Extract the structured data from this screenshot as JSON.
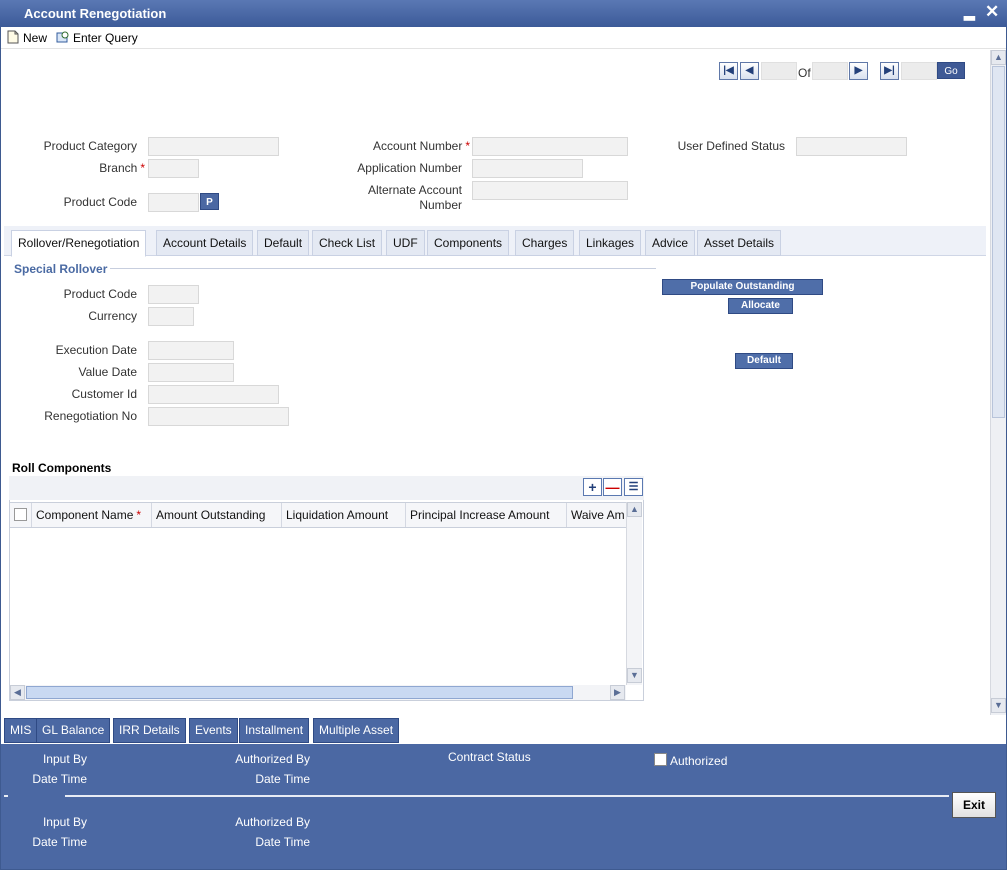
{
  "window": {
    "title": "Account Renegotiation"
  },
  "toolbar": {
    "new_label": "New",
    "enter_query_label": "Enter Query"
  },
  "pager": {
    "of_label": "Of",
    "go_label": "Go"
  },
  "header_fields": {
    "product_category": {
      "label": "Product Category",
      "value": ""
    },
    "branch": {
      "label": "Branch",
      "required": "*",
      "value": ""
    },
    "product_code": {
      "label": "Product Code",
      "value": "",
      "lookup_label": "P"
    },
    "account_number": {
      "label": "Account Number",
      "required": "*",
      "value": ""
    },
    "application_number": {
      "label": "Application Number",
      "value": ""
    },
    "alternate_account_number": {
      "label_line1": "Alternate Account",
      "label_line2": "Number",
      "value": ""
    },
    "user_defined_status": {
      "label": "User Defined Status",
      "value": ""
    }
  },
  "tabs": [
    {
      "label": "Rollover/Renegotiation",
      "active": true
    },
    {
      "label": "Account Details"
    },
    {
      "label": "Default"
    },
    {
      "label": "Check List"
    },
    {
      "label": "UDF"
    },
    {
      "label": "Components"
    },
    {
      "label": "Charges"
    },
    {
      "label": "Linkages"
    },
    {
      "label": "Advice"
    },
    {
      "label": "Asset Details"
    }
  ],
  "special_rollover": {
    "title": "Special Rollover",
    "product_code_label": "Product Code",
    "currency_label": "Currency",
    "execution_date_label": "Execution Date",
    "value_date_label": "Value Date",
    "customer_id_label": "Customer Id",
    "renegotiation_no_label": "Renegotiation No",
    "populate_outstanding_label": "Populate Outstanding",
    "allocate_label": "Allocate",
    "default_label": "Default"
  },
  "roll_components": {
    "title": "Roll Components",
    "columns": [
      {
        "label": "Component Name",
        "required": "*"
      },
      {
        "label": "Amount Outstanding"
      },
      {
        "label": "Liquidation Amount"
      },
      {
        "label": "Principal Increase Amount"
      },
      {
        "label": "Waive Am"
      }
    ],
    "rows": []
  },
  "bottom_tabs": [
    "MIS",
    "GL Balance",
    "IRR Details",
    "Events",
    "Installment",
    "Multiple Asset"
  ],
  "audit": {
    "input_by_label": "Input By",
    "date_time_label": "Date Time",
    "authorized_by_label": "Authorized By",
    "contract_status_label": "Contract Status",
    "authorized_checkbox_label": "Authorized",
    "exit_label": "Exit"
  }
}
